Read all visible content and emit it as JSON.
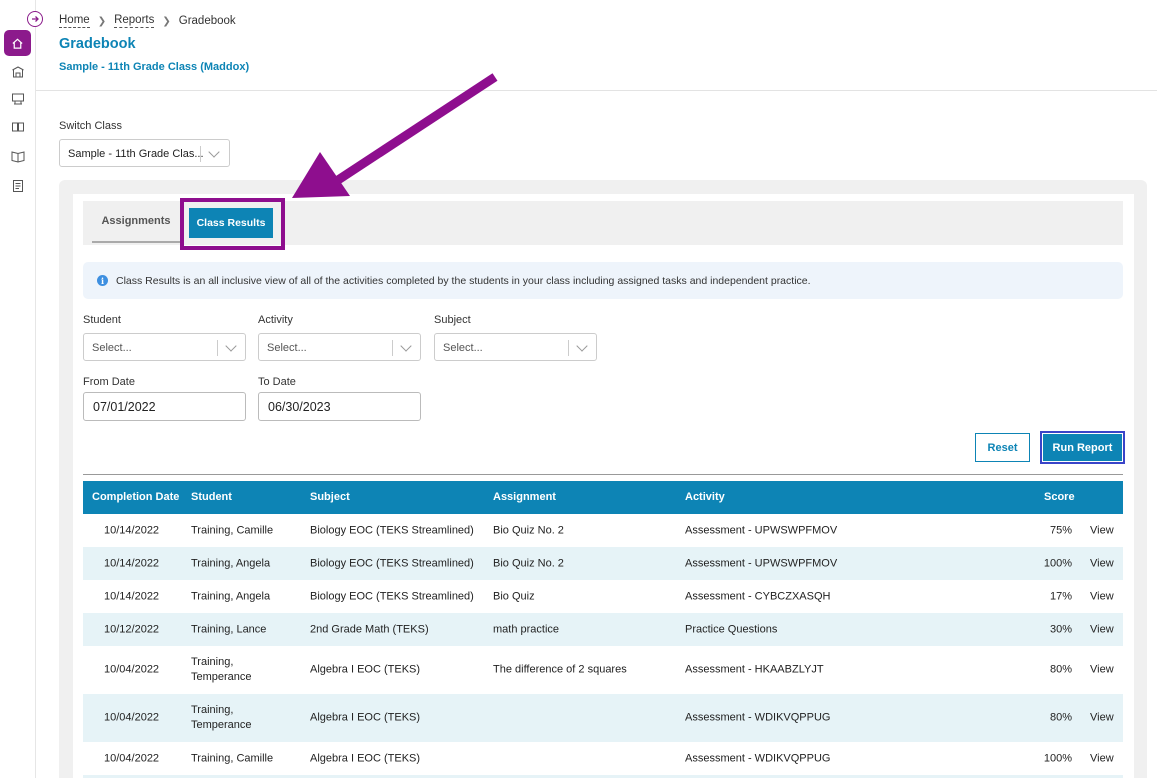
{
  "breadcrumb": {
    "home": "Home",
    "reports": "Reports",
    "current": "Gradebook"
  },
  "page": {
    "title": "Gradebook",
    "subtitle": "Sample - 11th Grade Class (Maddox)"
  },
  "switch_class": {
    "label": "Switch Class",
    "value": "Sample - 11th Grade Clas..."
  },
  "tabs": {
    "assignments": "Assignments",
    "class_results": "Class Results"
  },
  "info": {
    "text": "Class Results is an all inclusive view of all of the activities completed by the students in your class including assigned tasks and independent practice.",
    "icon": "i"
  },
  "filters": {
    "student": {
      "label": "Student",
      "placeholder": "Select..."
    },
    "activity": {
      "label": "Activity",
      "placeholder": "Select..."
    },
    "subject": {
      "label": "Subject",
      "placeholder": "Select..."
    },
    "from_date": {
      "label": "From Date",
      "value": "07/01/2022"
    },
    "to_date": {
      "label": "To Date",
      "value": "06/30/2023"
    }
  },
  "buttons": {
    "reset": "Reset",
    "run_report": "Run Report"
  },
  "table": {
    "headers": {
      "completion_date": "Completion Date",
      "student": "Student",
      "subject": "Subject",
      "assignment": "Assignment",
      "activity": "Activity",
      "score": "Score"
    },
    "rows": [
      {
        "date": "10/14/2022",
        "student": "Training, Camille",
        "subject": "Biology EOC (TEKS Streamlined)",
        "assignment": "Bio Quiz No. 2",
        "activity": "Assessment - UPWSWPFMOV",
        "score": "75%",
        "action": "View"
      },
      {
        "date": "10/14/2022",
        "student": "Training, Angela",
        "subject": "Biology EOC (TEKS Streamlined)",
        "assignment": "Bio Quiz No. 2",
        "activity": "Assessment - UPWSWPFMOV",
        "score": "100%",
        "action": "View"
      },
      {
        "date": "10/14/2022",
        "student": "Training, Angela",
        "subject": "Biology EOC (TEKS Streamlined)",
        "assignment": "Bio Quiz",
        "activity": "Assessment - CYBCZXASQH",
        "score": "17%",
        "action": "View"
      },
      {
        "date": "10/12/2022",
        "student": "Training, Lance",
        "subject": "2nd Grade Math (TEKS)",
        "assignment": "math practice",
        "activity": "Practice Questions",
        "score": "30%",
        "action": "View"
      },
      {
        "date": "10/04/2022",
        "student_l1": "Training,",
        "student_l2": "Temperance",
        "subject": "Algebra I EOC (TEKS)",
        "assignment": "The difference of 2 squares",
        "activity": "Assessment - HKAABZLYJT",
        "score": "80%",
        "action": "View"
      },
      {
        "date": "10/04/2022",
        "student_l1": "Training,",
        "student_l2": "Temperance",
        "subject": "Algebra I EOC (TEKS)",
        "assignment": "",
        "activity": "Assessment - WDIKVQPPUG",
        "score": "80%",
        "action": "View"
      },
      {
        "date": "10/04/2022",
        "student": "Training, Camille",
        "subject": "Algebra I EOC (TEKS)",
        "assignment": "",
        "activity": "Assessment - WDIKVQPPUG",
        "score": "100%",
        "action": "View"
      }
    ]
  },
  "colors": {
    "brand_purple": "#8c1a8c",
    "accent_blue": "#0d84b5",
    "annotation_purple": "#8e0e8e"
  }
}
